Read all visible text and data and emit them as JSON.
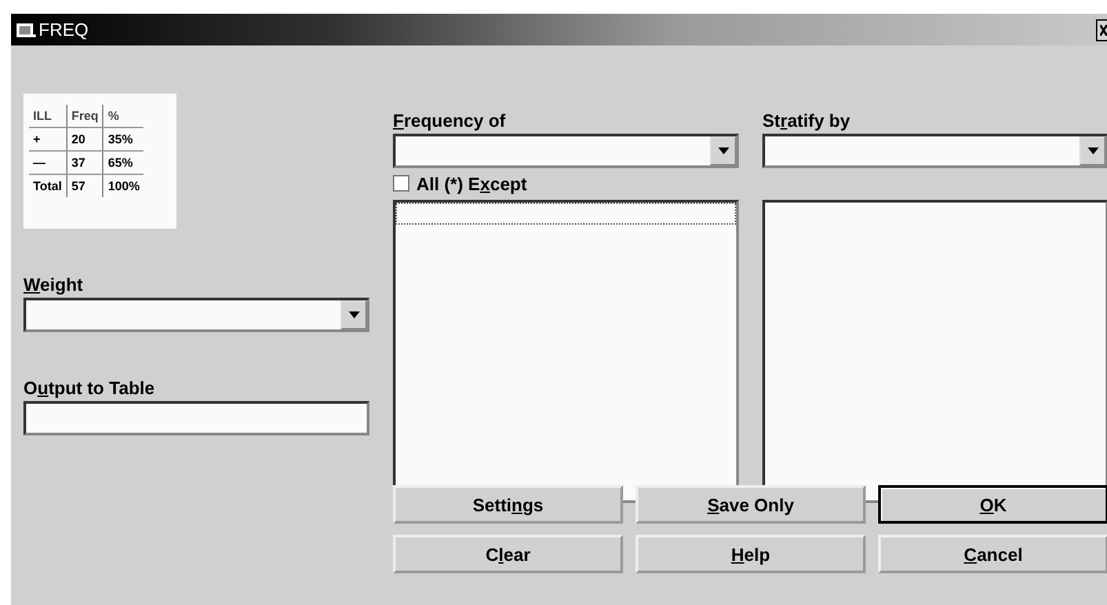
{
  "window": {
    "title": "FREQ"
  },
  "preview_table": {
    "columns": [
      "ILL",
      "Freq",
      "%"
    ],
    "rows": [
      [
        "+",
        "20",
        "35%"
      ],
      [
        "—",
        "37",
        "65%"
      ],
      [
        "Total",
        "57",
        "100%"
      ]
    ]
  },
  "weight": {
    "label": {
      "key": "W",
      "after": "eight"
    }
  },
  "output_to_table": {
    "label": {
      "before": "O",
      "key": "u",
      "after": "tput to Table"
    }
  },
  "frequency_of": {
    "label": {
      "key": "F",
      "after": "requency of"
    }
  },
  "stratify_by": {
    "label": {
      "before": "St",
      "key": "r",
      "after": "atify by"
    }
  },
  "all_except": {
    "label": {
      "before": "All (*) E",
      "key": "x",
      "after": "cept"
    },
    "checked": false
  },
  "buttons": [
    {
      "label": {
        "before": "Setti",
        "key": "n",
        "after": "gs"
      },
      "default": false
    },
    {
      "label": {
        "key": "S",
        "after": "ave Only"
      },
      "default": false
    },
    {
      "label": {
        "key": "O",
        "after": "K"
      },
      "default": true
    },
    {
      "label": {
        "before": "C",
        "key": "l",
        "after": "ear"
      },
      "default": false
    },
    {
      "label": {
        "key": "H",
        "after": "elp"
      },
      "default": false
    },
    {
      "label": {
        "key": "C",
        "after": "ancel"
      },
      "default": false
    }
  ]
}
